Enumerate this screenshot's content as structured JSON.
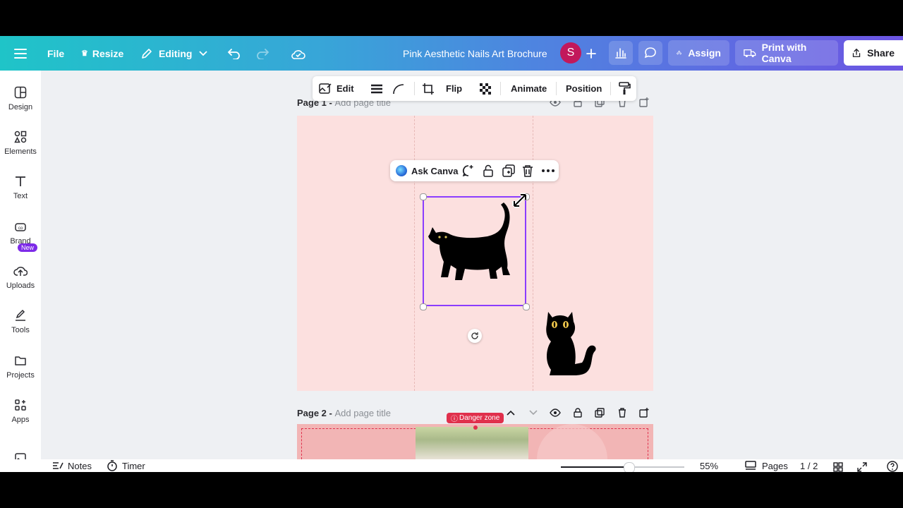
{
  "topbar": {
    "menu_icon": "hamburger-icon",
    "file": "File",
    "resize": "Resize",
    "editing": "Editing",
    "doc_title": "Pink Aesthetic Nails Art Brochure",
    "avatar_initial": "S",
    "assign": "Assign",
    "print": "Print with Canva",
    "share": "Share"
  },
  "sidebar": {
    "items": [
      {
        "label": "Design"
      },
      {
        "label": "Elements"
      },
      {
        "label": "Text"
      },
      {
        "label": "Brand"
      },
      {
        "label": "Uploads"
      },
      {
        "label": "Tools"
      },
      {
        "label": "Projects"
      },
      {
        "label": "Apps"
      }
    ],
    "new_badge": "New"
  },
  "context_toolbar": {
    "edit": "Edit",
    "flip": "Flip",
    "animate": "Animate",
    "position": "Position"
  },
  "element_toolbar": {
    "ask_canva": "Ask Canva"
  },
  "pages": [
    {
      "prefix": "Page 1 - ",
      "placeholder": "Add page title"
    },
    {
      "prefix": "Page 2 - ",
      "placeholder": "Add page title"
    }
  ],
  "danger_zone": "Danger zone",
  "bottombar": {
    "notes": "Notes",
    "timer": "Timer",
    "zoom": "55%",
    "zoom_fraction": 0.55,
    "pages_label": "Pages",
    "page_count": "1 / 2"
  },
  "colors": {
    "brand_purple": "#7d2ae8",
    "page_bg": "#fce0df",
    "danger": "#e0304c"
  }
}
